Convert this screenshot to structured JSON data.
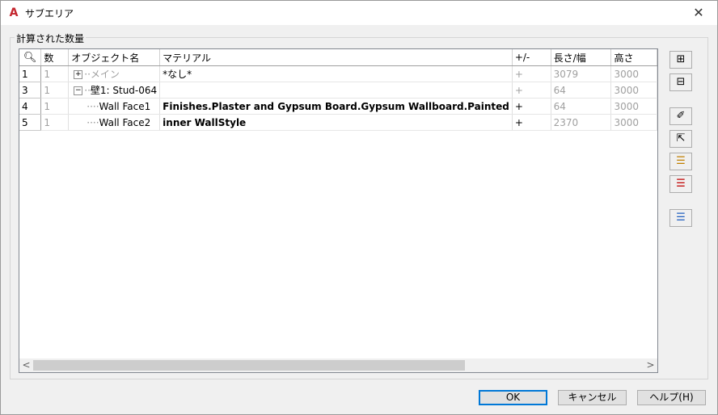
{
  "window": {
    "title": "サブエリア",
    "close": "✕"
  },
  "group": {
    "label": "計算された数量"
  },
  "table": {
    "headers": [
      "",
      "数",
      "オブジェクト名",
      "マテリアル",
      "+/-",
      "長さ/幅",
      "高さ"
    ],
    "rows": [
      {
        "rownum": "1",
        "count": "1",
        "object": "メイン",
        "expander": "+",
        "material": "*なし*",
        "plusminus": "+",
        "length": "3079",
        "height": "3000"
      },
      {
        "rownum": "3",
        "count": "1",
        "object": "壁1: Stud-064",
        "expander": "−",
        "material": "",
        "plusminus": "+",
        "length": "64",
        "height": "3000"
      },
      {
        "rownum": "4",
        "count": "1",
        "object": "Wall Face1",
        "material": "Finishes.Plaster and Gypsum Board.Gypsum Wallboard.Painted",
        "plusminus": "+",
        "length": "64",
        "height": "3000"
      },
      {
        "rownum": "5",
        "count": "1",
        "object": "Wall Face2",
        "material": "inner WallStyle",
        "plusminus": "+",
        "length": "2370",
        "height": "3000"
      }
    ]
  },
  "scrollbar": {
    "left": "<",
    "right": ">"
  },
  "side_buttons": [
    {
      "name": "add-icon",
      "glyph": "⊞"
    },
    {
      "name": "remove-icon",
      "glyph": "⊟"
    },
    {
      "name": "pick-icon",
      "glyph": "✐"
    },
    {
      "name": "select-icon",
      "glyph": "⇱"
    },
    {
      "name": "add-list-icon",
      "glyph": "☰"
    },
    {
      "name": "delete-list-icon",
      "glyph": "☰"
    },
    {
      "name": "import-list-icon",
      "glyph": "☰"
    }
  ],
  "buttons": {
    "ok": "OK",
    "cancel": "キャンセル",
    "help": "ヘルプ(H)"
  },
  "colors": {
    "accent": "#0078d7",
    "app_icon": "#c4262e"
  }
}
